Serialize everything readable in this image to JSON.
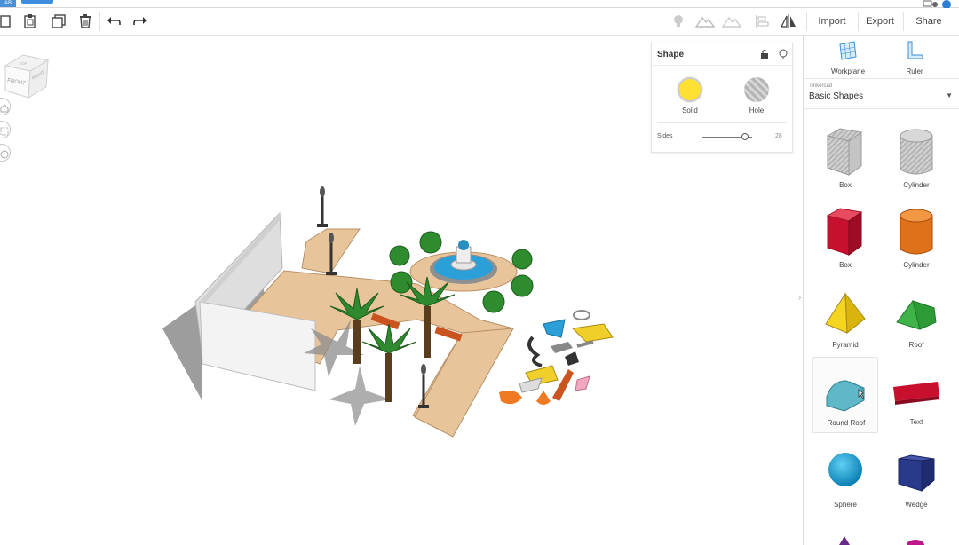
{
  "toolbar": {
    "import_label": "Import",
    "export_label": "Export",
    "share_label": "Share"
  },
  "top_strip": {
    "app_badge": "AB"
  },
  "viewcube": {
    "top_face": "TOP",
    "front_face": "FRONT",
    "right_face": "RIGHT"
  },
  "shape_panel": {
    "title": "Shape",
    "solid_label": "Solid",
    "hole_label": "Hole",
    "sides_label": "Sides",
    "sides_value": "28",
    "sides_fraction": 0.86,
    "colors": {
      "solid": "#ffe033",
      "hole": "#c0c0c0"
    }
  },
  "sidebar": {
    "workplane_label": "Workplane",
    "ruler_label": "Ruler",
    "category_small": "Tinkercad",
    "category": "Basic Shapes",
    "shapes": [
      {
        "label": "Box",
        "icon": "box-hole-icon"
      },
      {
        "label": "Cylinder",
        "icon": "cylinder-hole-icon"
      },
      {
        "label": "Box",
        "icon": "box-red-icon"
      },
      {
        "label": "Cylinder",
        "icon": "cylinder-orange-icon"
      },
      {
        "label": "Pyramid",
        "icon": "pyramid-icon"
      },
      {
        "label": "Roof",
        "icon": "roof-icon"
      },
      {
        "label": "Round Roof",
        "icon": "round-roof-icon"
      },
      {
        "label": "Text",
        "icon": "text-shape-icon"
      },
      {
        "label": "Sphere",
        "icon": "sphere-icon"
      },
      {
        "label": "Wedge",
        "icon": "wedge-icon"
      }
    ]
  },
  "accent": "#3d8ee0"
}
